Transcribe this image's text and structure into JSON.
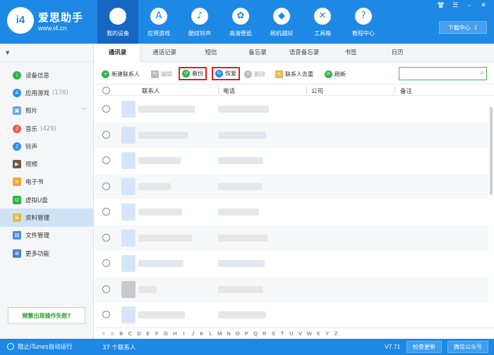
{
  "header": {
    "logo_badge": "i4",
    "logo_name": "爱思助手",
    "logo_url": "www.i4.cn",
    "nav": [
      {
        "label": "我的设备",
        "icon": "apple-icon",
        "glyph": ""
      },
      {
        "label": "应用游戏",
        "icon": "app-store-icon",
        "glyph": "A"
      },
      {
        "label": "酷炫铃声",
        "icon": "bell-icon",
        "glyph": "♪"
      },
      {
        "label": "高清壁纸",
        "icon": "flower-icon",
        "glyph": "✿"
      },
      {
        "label": "刷机越狱",
        "icon": "dropbox-icon",
        "glyph": "◆"
      },
      {
        "label": "工具箱",
        "icon": "tools-icon",
        "glyph": "✕"
      },
      {
        "label": "教程中心",
        "icon": "help-icon",
        "glyph": "?"
      }
    ],
    "download_center": "下载中心"
  },
  "sidebar": {
    "items": [
      {
        "label": "设备信息",
        "count": "",
        "icon": "info-icon",
        "color": "#2fb34a",
        "glyph": "i"
      },
      {
        "label": "应用游戏",
        "count": "(178)",
        "icon": "app-store-icon",
        "color": "#2a8fe8",
        "glyph": "A"
      },
      {
        "label": "照片",
        "count": "",
        "icon": "photo-icon",
        "color": "#6aa9e6",
        "glyph": "▣"
      },
      {
        "label": "音乐",
        "count": "(429)",
        "icon": "music-icon",
        "color": "#f05a5a",
        "glyph": "♪"
      },
      {
        "label": "铃声",
        "count": "",
        "icon": "bell-icon",
        "color": "#2a8fe8",
        "glyph": "♫"
      },
      {
        "label": "视频",
        "count": "",
        "icon": "video-icon",
        "color": "#6b5a48",
        "glyph": "▶"
      },
      {
        "label": "电子书",
        "count": "",
        "icon": "book-icon",
        "color": "#f0a830",
        "glyph": "≡"
      },
      {
        "label": "虚拟U盘",
        "count": "",
        "icon": "usb-icon",
        "color": "#2fb34a",
        "glyph": "U"
      },
      {
        "label": "资料管理",
        "count": "",
        "icon": "contacts-icon",
        "color": "#e8b84a",
        "glyph": "≣"
      },
      {
        "label": "文件管理",
        "count": "",
        "icon": "folder-icon",
        "color": "#4a90d9",
        "glyph": "▤"
      },
      {
        "label": "更多功能",
        "count": "",
        "icon": "grid-icon",
        "color": "#4a7fc9",
        "glyph": "⊞"
      }
    ],
    "help_button": "频繁出现操作失败?"
  },
  "tabs": [
    "通讯录",
    "通话记录",
    "短信",
    "备忘录",
    "语音备忘录",
    "书签",
    "日历"
  ],
  "toolbar": {
    "new_contact": "新建联系人",
    "edit": "编辑",
    "backup": "备份",
    "restore": "恢复",
    "delete": "删除",
    "dedupe": "联系人去重",
    "refresh": "刷新",
    "search_placeholder": ""
  },
  "table": {
    "columns": [
      "联系人",
      "电话",
      "公司",
      "备注"
    ]
  },
  "alphabet": [
    "#",
    "A",
    "B",
    "C",
    "D",
    "E",
    "F",
    "G",
    "H",
    "I",
    "J",
    "K",
    "L",
    "M",
    "N",
    "O",
    "P",
    "Q",
    "R",
    "S",
    "T",
    "U",
    "V",
    "W",
    "X",
    "Y",
    "Z"
  ],
  "status": {
    "itunes_block": "阻止iTunes自动运行",
    "contact_count": "37 个联系人",
    "version": "V7.71",
    "check_update": "检查更新",
    "wechat": "微信公众号"
  },
  "colors": {
    "brand_blue": "#1e88e5",
    "highlight_red": "#e02020",
    "accent_green": "#2fb34a"
  }
}
